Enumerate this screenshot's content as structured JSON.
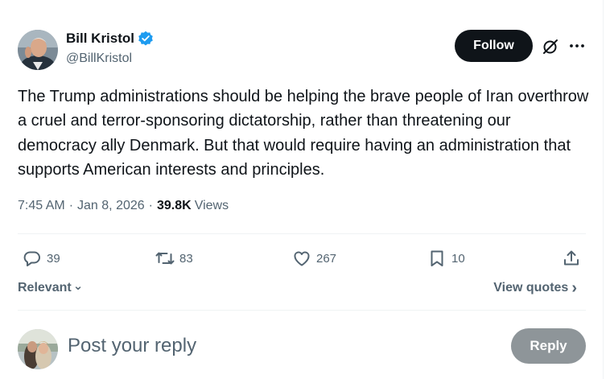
{
  "author": {
    "name": "Bill Kristol",
    "handle": "@BillKristol",
    "verified": true
  },
  "follow_label": "Follow",
  "icons": {
    "verified": "verified-badge-icon",
    "grok": "grok-icon",
    "more": "more-icon",
    "reply": "reply-icon",
    "retweet": "retweet-icon",
    "like": "like-icon",
    "bookmark": "bookmark-icon",
    "share": "share-icon"
  },
  "tweet": {
    "text": "The Trump administrations should be helping the brave people of Iran overthrow a cruel and terror-sponsoring dictatorship, rather than threatening our democracy ally Denmark. But that would require having an administration that supports American interests and principles.",
    "time": "7:45 AM",
    "date": "Jan 8, 2026",
    "views_count": "39.8K",
    "views_label": "Views",
    "separator": "·"
  },
  "actions": {
    "replies": "39",
    "retweets": "83",
    "likes": "267",
    "bookmarks": "10"
  },
  "sort": {
    "label": "Relevant",
    "chevron": "⌄"
  },
  "view_quotes": {
    "label": "View quotes",
    "chevron": "›"
  },
  "composer": {
    "placeholder": "Post your reply",
    "reply_label": "Reply"
  },
  "colors": {
    "text": "#0f1419",
    "secondary": "#536471",
    "verified": "#1d9bf0",
    "follow_bg": "#0f1419",
    "reply_bg_disabled": "#8e9599",
    "divider": "#eff3f4"
  }
}
